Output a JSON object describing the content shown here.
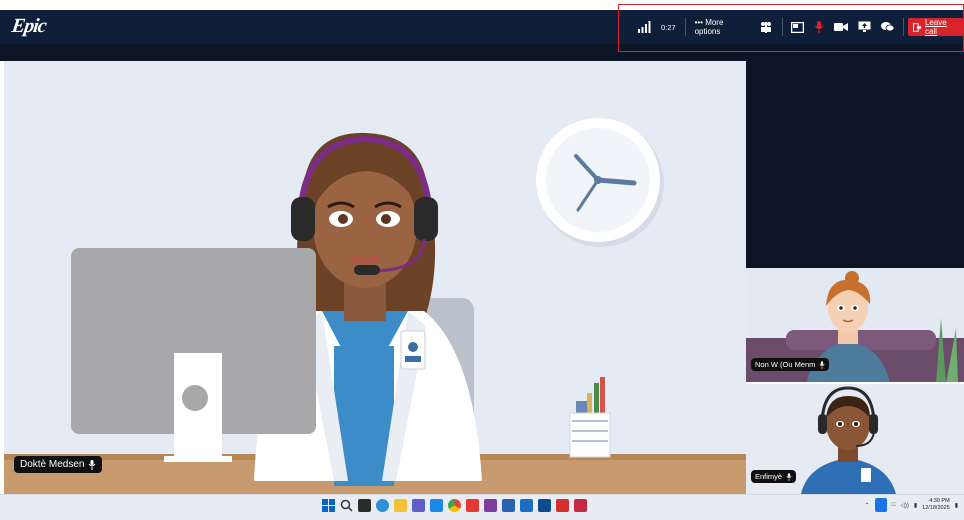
{
  "app": {
    "logo_text": "Epic"
  },
  "toolbar": {
    "call_timer": "0:27",
    "more_options_label": "••• More options",
    "leave_label": "Leave call"
  },
  "participants": {
    "main": {
      "name": "Doktè Medsen"
    },
    "tile1": {
      "name": "Non W (Ou Menm"
    },
    "tile2": {
      "name": "Enfimyè"
    }
  },
  "taskbar": {
    "time": "4:30 PM",
    "date": "12/18/2025",
    "volume_label": "◁)) "
  },
  "colors": {
    "topbar": "#0f1f3a",
    "leave_button": "#d8232a",
    "highlight_border": "#d8232a"
  }
}
